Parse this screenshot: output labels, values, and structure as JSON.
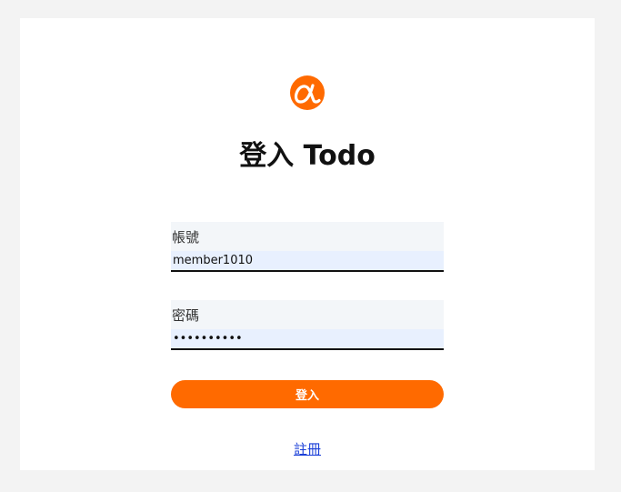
{
  "page": {
    "title": "登入 Todo"
  },
  "logo": {
    "icon": "alpha-logo-icon",
    "color": "#ff6a00"
  },
  "form": {
    "account": {
      "label": "帳號",
      "value": "member1010"
    },
    "password": {
      "label": "密碼",
      "value": "••••••••••"
    },
    "submit_label": "登入",
    "register_label": "註冊"
  },
  "colors": {
    "accent": "#ff6a00",
    "link": "#1a3fd8",
    "background": "#f3f3f3",
    "card": "#ffffff",
    "field_label_bg": "#f3f6f9",
    "autofill_bg": "#e8f0fe"
  }
}
